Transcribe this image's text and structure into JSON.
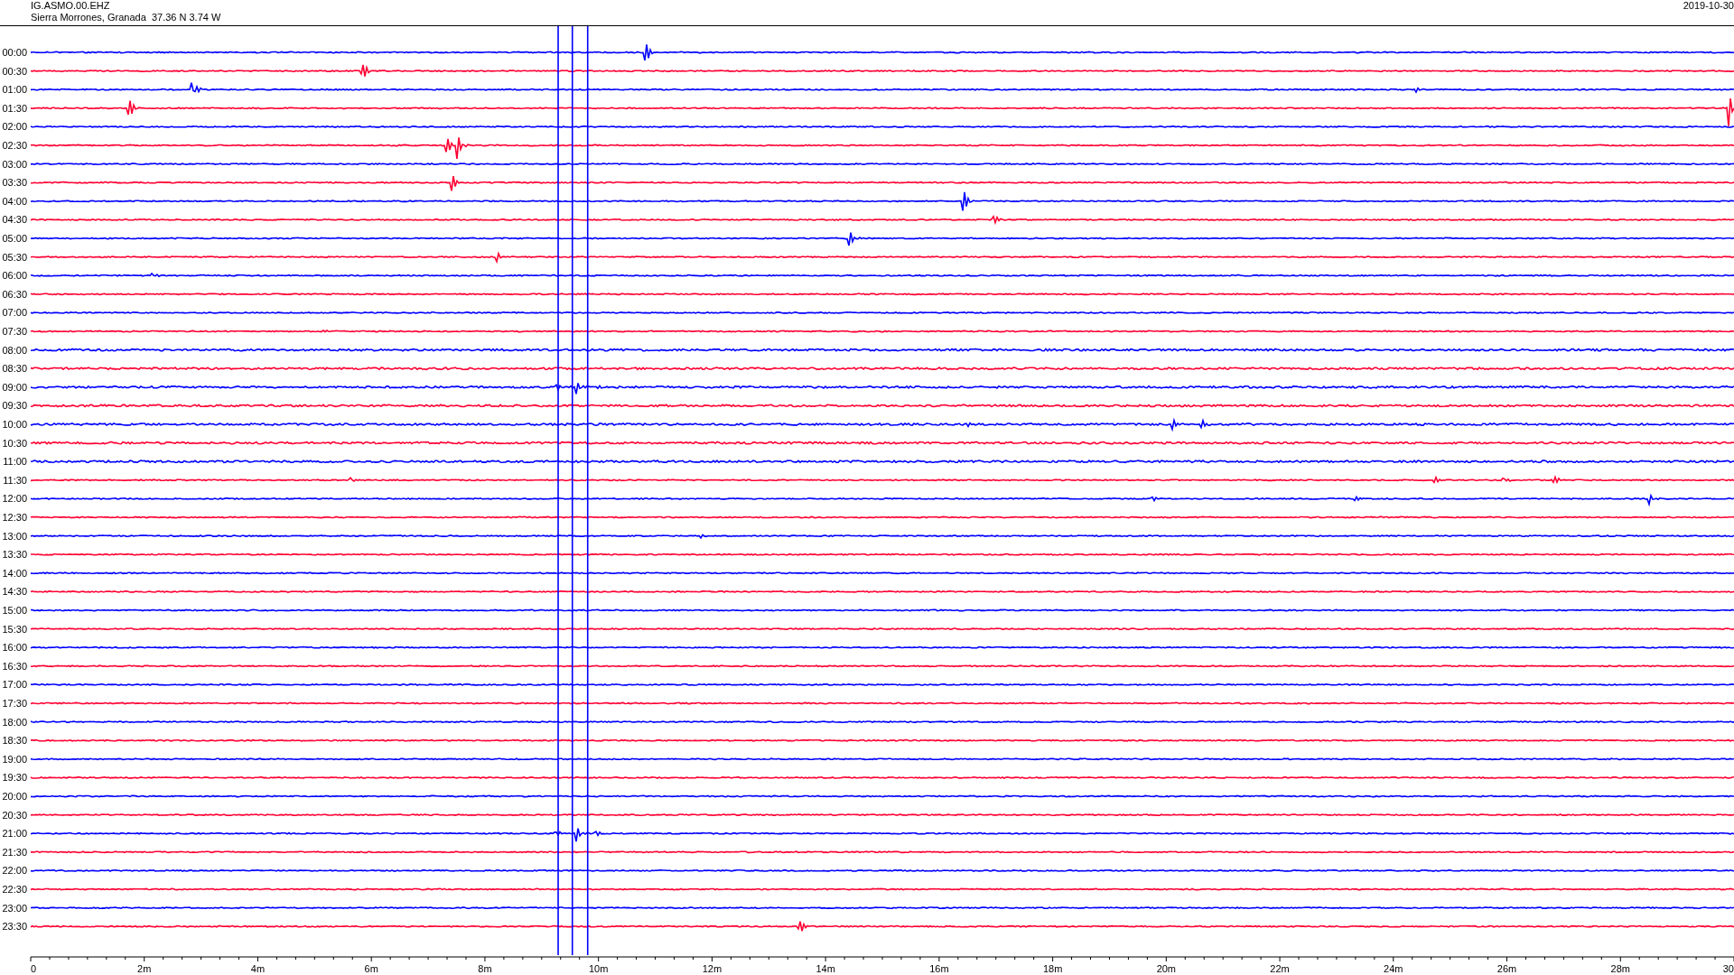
{
  "header": {
    "station": "IG.ASMO.00.EHZ",
    "location": "Sierra Morrones, Granada  37.36 N 3.74 W",
    "date": "2019-10-30"
  },
  "rows": [
    {
      "label": "00:00",
      "color": "#0000ff"
    },
    {
      "label": "00:30",
      "color": "#ff0033"
    },
    {
      "label": "01:00",
      "color": "#0000ff"
    },
    {
      "label": "01:30",
      "color": "#ff0033"
    },
    {
      "label": "02:00",
      "color": "#0000ff"
    },
    {
      "label": "02:30",
      "color": "#ff0033"
    },
    {
      "label": "03:00",
      "color": "#0000ff"
    },
    {
      "label": "03:30",
      "color": "#ff0033"
    },
    {
      "label": "04:00",
      "color": "#0000ff"
    },
    {
      "label": "04:30",
      "color": "#ff0033"
    },
    {
      "label": "05:00",
      "color": "#0000ff"
    },
    {
      "label": "05:30",
      "color": "#ff0033"
    },
    {
      "label": "06:00",
      "color": "#0000ff"
    },
    {
      "label": "06:30",
      "color": "#ff0033"
    },
    {
      "label": "07:00",
      "color": "#0000ff"
    },
    {
      "label": "07:30",
      "color": "#ff0033"
    },
    {
      "label": "08:00",
      "color": "#0000ff"
    },
    {
      "label": "08:30",
      "color": "#ff0033"
    },
    {
      "label": "09:00",
      "color": "#0000ff"
    },
    {
      "label": "09:30",
      "color": "#ff0033"
    },
    {
      "label": "10:00",
      "color": "#0000ff"
    },
    {
      "label": "10:30",
      "color": "#ff0033"
    },
    {
      "label": "11:00",
      "color": "#0000ff"
    },
    {
      "label": "11:30",
      "color": "#ff0033"
    },
    {
      "label": "12:00",
      "color": "#0000ff"
    },
    {
      "label": "12:30",
      "color": "#ff0033"
    },
    {
      "label": "13:00",
      "color": "#0000ff"
    },
    {
      "label": "13:30",
      "color": "#ff0033"
    },
    {
      "label": "14:00",
      "color": "#0000ff"
    },
    {
      "label": "14:30",
      "color": "#ff0033"
    },
    {
      "label": "15:00",
      "color": "#0000ff"
    },
    {
      "label": "15:30",
      "color": "#ff0033"
    },
    {
      "label": "16:00",
      "color": "#0000ff"
    },
    {
      "label": "16:30",
      "color": "#ff0033"
    },
    {
      "label": "17:00",
      "color": "#0000ff"
    },
    {
      "label": "17:30",
      "color": "#ff0033"
    },
    {
      "label": "18:00",
      "color": "#0000ff"
    },
    {
      "label": "18:30",
      "color": "#ff0033"
    },
    {
      "label": "19:00",
      "color": "#0000ff"
    },
    {
      "label": "19:30",
      "color": "#ff0033"
    },
    {
      "label": "20:00",
      "color": "#0000ff"
    },
    {
      "label": "20:30",
      "color": "#ff0033"
    },
    {
      "label": "21:00",
      "color": "#0000ff"
    },
    {
      "label": "21:30",
      "color": "#ff0033"
    },
    {
      "label": "22:00",
      "color": "#0000ff"
    },
    {
      "label": "22:30",
      "color": "#ff0033"
    },
    {
      "label": "23:00",
      "color": "#0000ff"
    },
    {
      "label": "23:30",
      "color": "#ff0033"
    }
  ],
  "x_axis": {
    "labels": [
      "0",
      "2m",
      "4m",
      "6m",
      "8m",
      "10m",
      "12m",
      "14m",
      "16m",
      "18m",
      "20m",
      "22m",
      "24m",
      "26m",
      "28m",
      "30"
    ]
  }
}
